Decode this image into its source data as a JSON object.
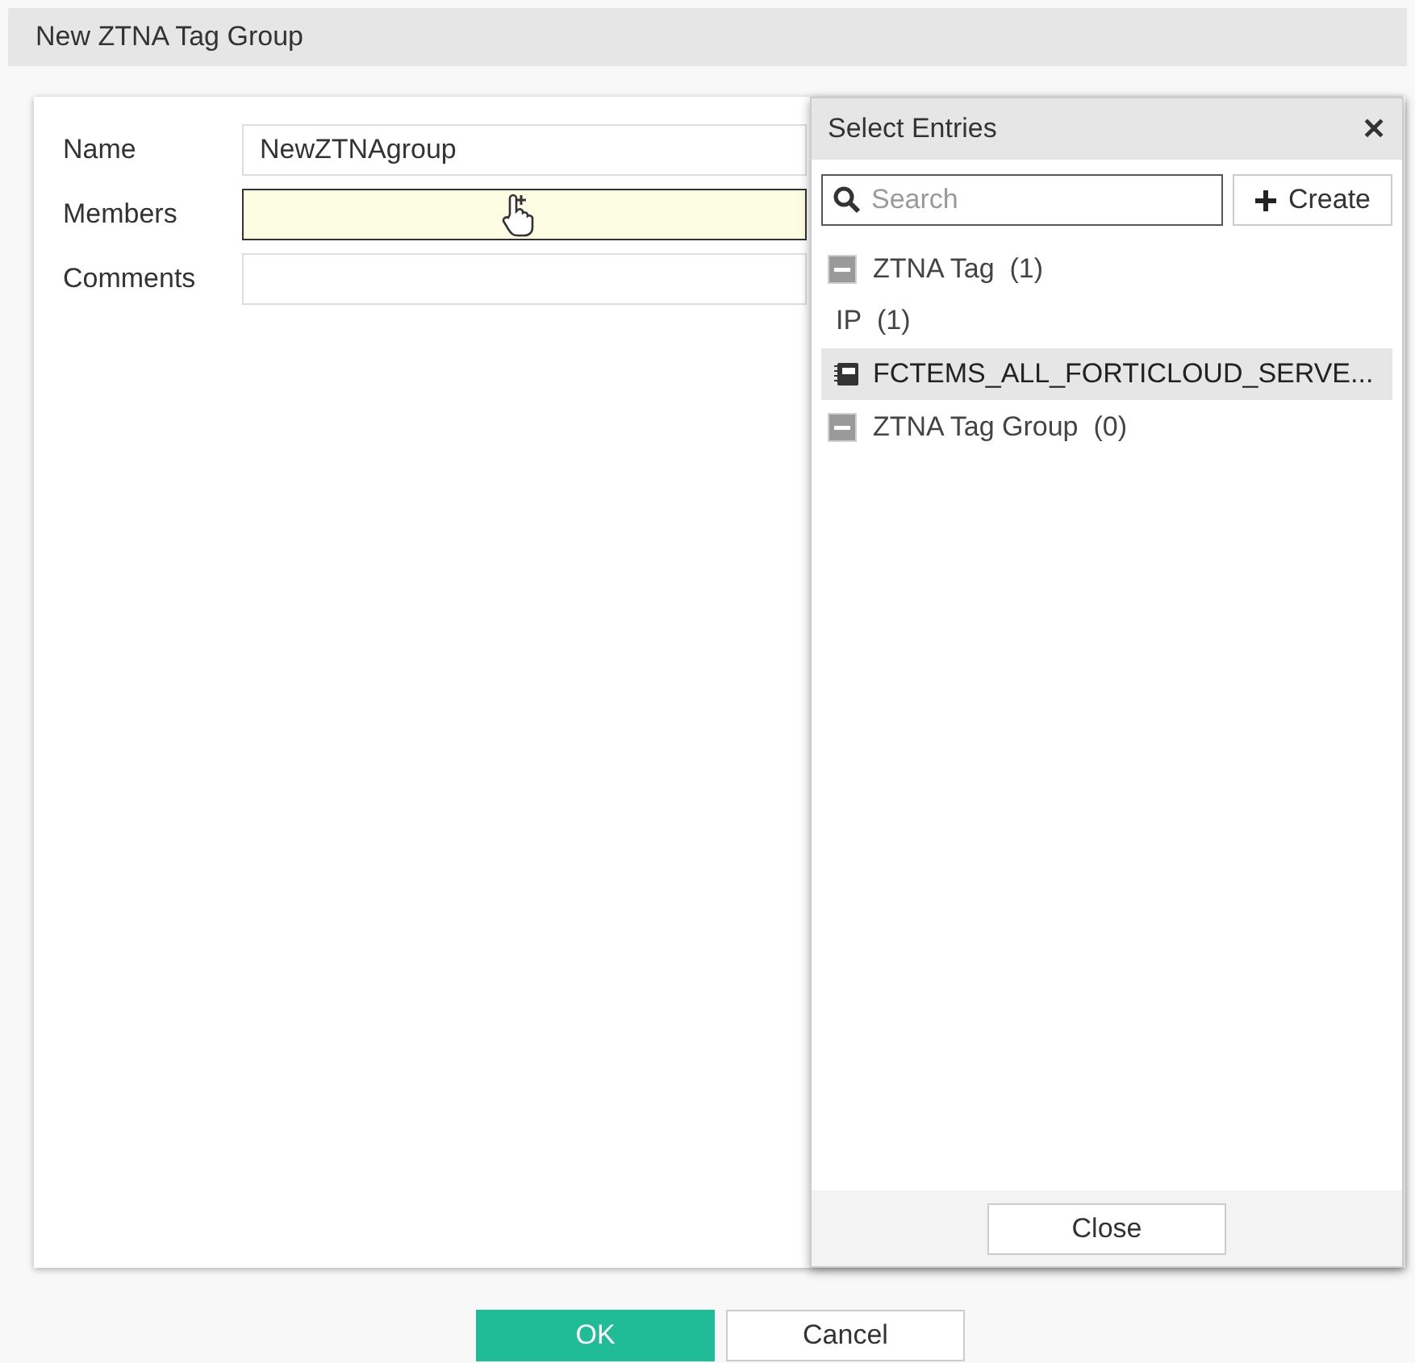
{
  "window": {
    "title": "New ZTNA Tag Group"
  },
  "form": [
    {
      "label": "Name",
      "value": "NewZTNAgroup",
      "focused": false
    },
    {
      "label": "Members",
      "focused": true
    },
    {
      "label": "Comments",
      "focused": false
    }
  ],
  "panel": {
    "title": "Select Entries",
    "close_icon": "✕",
    "search": {
      "placeholder": "Search"
    },
    "create_button": "Create",
    "tree": [
      {
        "label": "ZTNA Tag",
        "count": "(1)",
        "expanded": true,
        "children": [
          {
            "label": "IP",
            "count": "(1)",
            "children": [
              {
                "label": "FCTEMS_ALL_FORTICLOUD_SERVE...",
                "selected": true
              }
            ]
          }
        ]
      },
      {
        "label": "ZTNA Tag Group",
        "count": "(0)",
        "expanded": true
      }
    ],
    "close_button": "Close"
  },
  "buttons": [
    {
      "label": "OK",
      "kind": "primary"
    },
    {
      "label": "Cancel",
      "kind": "secondary"
    }
  ]
}
